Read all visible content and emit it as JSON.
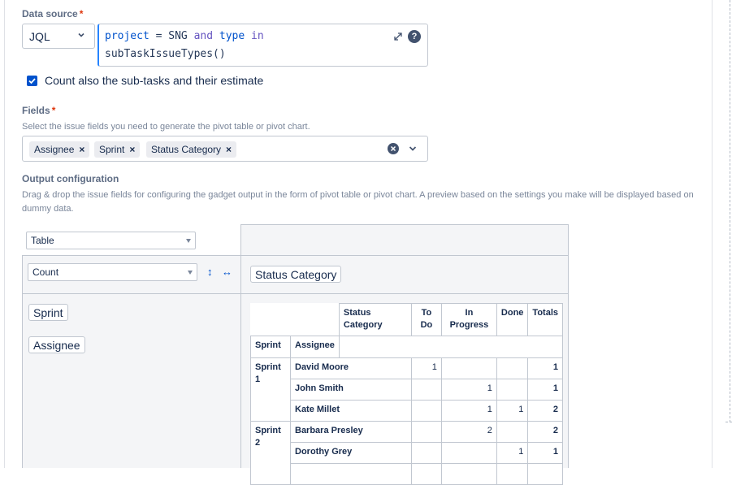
{
  "data_source": {
    "label": "Data source",
    "required_mark": "*",
    "mode": "JQL",
    "jql": {
      "project_kw": "project",
      "eq": "=",
      "project_val": "SNG",
      "and_kw": "and",
      "type_kw": "type",
      "in_kw": "in",
      "func": "subTaskIssueTypes()"
    },
    "help_glyph": "?",
    "expand_icon": "expand-icon"
  },
  "subtasks": {
    "checked": true,
    "label": "Count also the sub-tasks and their estimate"
  },
  "fields": {
    "label": "Fields",
    "required_mark": "*",
    "helper": "Select the issue fields you need to generate the pivot table or pivot chart.",
    "chips": [
      "Assignee",
      "Sprint",
      "Status Category"
    ],
    "remove_glyph": "×"
  },
  "output": {
    "label": "Output configuration",
    "helper": "Drag & drop the issue fields for configuring the gadget output in the form of pivot table or pivot chart. A preview based on the settings you make will be displayed based on dummy data.",
    "view_type": "Table",
    "aggregation": "Count",
    "sort_vertical_glyph": "↕",
    "sort_horizontal_glyph": "↔",
    "column_field": "Status Category",
    "row_fields": [
      "Sprint",
      "Assignee"
    ]
  },
  "pivot": {
    "header_status": "Status Category",
    "col_todo": "To Do",
    "col_inprogress": "In Progress",
    "col_done": "Done",
    "col_totals": "Totals",
    "row_hdr_sprint": "Sprint",
    "row_hdr_assignee": "Assignee",
    "rows": [
      {
        "sprint": "Sprint 1",
        "assignee": "David Moore",
        "todo": "1",
        "inprogress": "",
        "done": "",
        "total": "1"
      },
      {
        "sprint": "",
        "assignee": "John Smith",
        "todo": "",
        "inprogress": "1",
        "done": "",
        "total": "1"
      },
      {
        "sprint": "",
        "assignee": "Kate Millet",
        "todo": "",
        "inprogress": "1",
        "done": "1",
        "total": "2"
      },
      {
        "sprint": "Sprint 2",
        "assignee": "Barbara Presley",
        "todo": "",
        "inprogress": "2",
        "done": "",
        "total": "2"
      },
      {
        "sprint": "",
        "assignee": "Dorothy Grey",
        "todo": "",
        "inprogress": "",
        "done": "1",
        "total": "1"
      }
    ]
  },
  "colors": {
    "accent": "#0052cc",
    "required": "#de350b",
    "border": "#c1c7d0",
    "panel": "#f4f5f7"
  }
}
